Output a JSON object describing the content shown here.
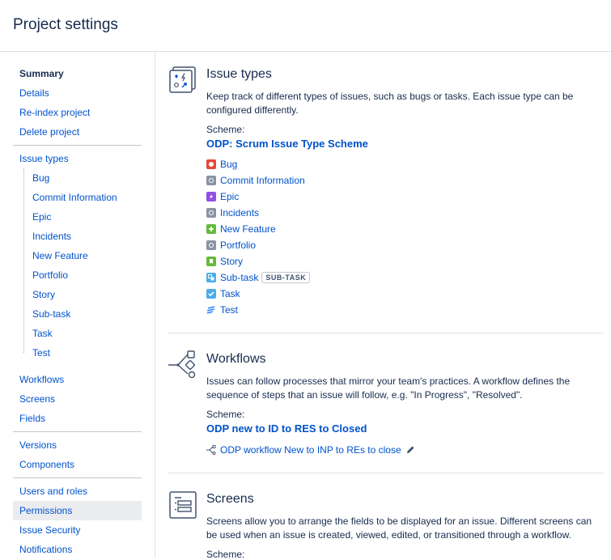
{
  "header": {
    "title": "Project settings"
  },
  "sidebar": {
    "summary": "Summary",
    "details": "Details",
    "reindex": "Re-index project",
    "delete": "Delete project",
    "issue_types": "Issue types",
    "issue_type_items": [
      "Bug",
      "Commit Information",
      "Epic",
      "Incidents",
      "New Feature",
      "Portfolio",
      "Story",
      "Sub-task",
      "Task",
      "Test"
    ],
    "workflows": "Workflows",
    "screens": "Screens",
    "fields": "Fields",
    "versions": "Versions",
    "components": "Components",
    "users_roles": "Users and roles",
    "permissions": "Permissions",
    "issue_security": "Issue Security",
    "notifications": "Notifications"
  },
  "issue_types": {
    "title": "Issue types",
    "description": "Keep track of different types of issues, such as bugs or tasks. Each issue type can be configured differently.",
    "scheme_label": "Scheme:",
    "scheme_name": "ODP: Scrum Issue Type Scheme",
    "items": [
      {
        "name": "Bug",
        "icon": "bug-icon"
      },
      {
        "name": "Commit Information",
        "icon": "generic-type-icon"
      },
      {
        "name": "Epic",
        "icon": "epic-icon"
      },
      {
        "name": "Incidents",
        "icon": "generic-type-icon"
      },
      {
        "name": "New Feature",
        "icon": "new-feature-icon"
      },
      {
        "name": "Portfolio",
        "icon": "generic-type-icon"
      },
      {
        "name": "Story",
        "icon": "story-icon"
      },
      {
        "name": "Sub-task",
        "icon": "subtask-icon",
        "badge": "SUB-TASK"
      },
      {
        "name": "Task",
        "icon": "task-icon"
      },
      {
        "name": "Test",
        "icon": "test-icon"
      }
    ]
  },
  "workflows": {
    "title": "Workflows",
    "description": "Issues can follow processes that mirror your team's practices. A workflow defines the sequence of steps that an issue will follow, e.g. \"In Progress\", \"Resolved\".",
    "scheme_label": "Scheme:",
    "scheme_name": "ODP new to ID to RES to Closed",
    "workflow_link": "ODP workflow New to INP to REs to close"
  },
  "screens": {
    "title": "Screens",
    "description": "Screens allow you to arrange the fields to be displayed for an issue. Different screens can be used when an issue is created, viewed, edited, or transitioned through a workflow.",
    "scheme_label": "Scheme:"
  },
  "colors": {
    "link": "#0052cc",
    "text": "#172b4d",
    "bug": "#e5493a",
    "generic": "#8993a4",
    "epic": "#904ee2",
    "new_feature": "#63ba3c",
    "story": "#63ba3c",
    "subtask": "#4bade8",
    "task": "#4bade8",
    "selected_bg": "#ebecf0"
  }
}
